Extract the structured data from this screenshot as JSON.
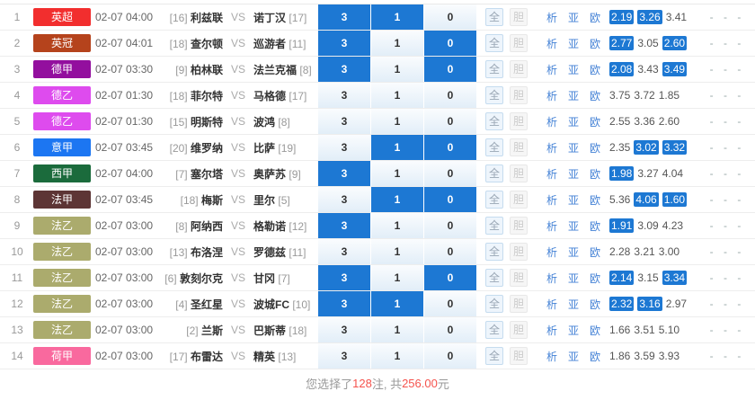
{
  "controls": {
    "pick_labels": [
      "3",
      "1",
      "0"
    ],
    "all_label": "全",
    "dan_label": "胆",
    "links": [
      "析",
      "亚",
      "欧"
    ],
    "vs_label": "VS",
    "dash": "- - -"
  },
  "colors": {
    "selected_blue": "#1d78d3",
    "link_blue": "#4482d6",
    "red": "#f5534d",
    "leagues": {
      "英超": "#f22e2e",
      "英冠": "#b5431c",
      "德甲": "#930f9e",
      "德乙": "#de4bee",
      "意甲": "#1c76f2",
      "西甲": "#1b6b3c",
      "法甲": "#5d3535",
      "法乙": "#abab6d",
      "荷甲": "#f9699e"
    }
  },
  "rows": [
    {
      "no": "1",
      "league": "英超",
      "time": "02-07 04:00",
      "home_rank": "[16]",
      "home": "利兹联",
      "away": "诺丁汉",
      "away_rank": "[17]",
      "picks": [
        true,
        true,
        false
      ],
      "odds": [
        "2.19",
        "3.26",
        "3.41"
      ]
    },
    {
      "no": "2",
      "league": "英冠",
      "time": "02-07 04:01",
      "home_rank": "[18]",
      "home": "查尔顿",
      "away": "巡游者",
      "away_rank": "[11]",
      "picks": [
        true,
        false,
        true
      ],
      "odds": [
        "2.77",
        "3.05",
        "2.60"
      ]
    },
    {
      "no": "3",
      "league": "德甲",
      "time": "02-07 03:30",
      "home_rank": "[9]",
      "home": "柏林联",
      "away": "法兰克福",
      "away_rank": "[8]",
      "picks": [
        true,
        false,
        true
      ],
      "odds": [
        "2.08",
        "3.43",
        "3.49"
      ]
    },
    {
      "no": "4",
      "league": "德乙",
      "time": "02-07 01:30",
      "home_rank": "[18]",
      "home": "菲尔特",
      "away": "马格德",
      "away_rank": "[17]",
      "picks": [
        false,
        false,
        false
      ],
      "odds": [
        "3.75",
        "3.72",
        "1.85"
      ]
    },
    {
      "no": "5",
      "league": "德乙",
      "time": "02-07 01:30",
      "home_rank": "[15]",
      "home": "明斯特",
      "away": "波鸿",
      "away_rank": "[8]",
      "picks": [
        false,
        false,
        false
      ],
      "odds": [
        "2.55",
        "3.36",
        "2.60"
      ]
    },
    {
      "no": "6",
      "league": "意甲",
      "time": "02-07 03:45",
      "home_rank": "[20]",
      "home": "维罗纳",
      "away": "比萨",
      "away_rank": "[19]",
      "picks": [
        false,
        true,
        true
      ],
      "odds": [
        "2.35",
        "3.02",
        "3.32"
      ]
    },
    {
      "no": "7",
      "league": "西甲",
      "time": "02-07 04:00",
      "home_rank": "[7]",
      "home": "塞尔塔",
      "away": "奥萨苏",
      "away_rank": "[9]",
      "picks": [
        true,
        false,
        false
      ],
      "odds": [
        "1.98",
        "3.27",
        "4.04"
      ]
    },
    {
      "no": "8",
      "league": "法甲",
      "time": "02-07 03:45",
      "home_rank": "[18]",
      "home": "梅斯",
      "away": "里尔",
      "away_rank": "[5]",
      "picks": [
        false,
        true,
        true
      ],
      "odds": [
        "5.36",
        "4.06",
        "1.60"
      ]
    },
    {
      "no": "9",
      "league": "法乙",
      "time": "02-07 03:00",
      "home_rank": "[8]",
      "home": "阿纳西",
      "away": "格勒诺",
      "away_rank": "[12]",
      "picks": [
        true,
        false,
        false
      ],
      "odds": [
        "1.91",
        "3.09",
        "4.23"
      ]
    },
    {
      "no": "10",
      "league": "法乙",
      "time": "02-07 03:00",
      "home_rank": "[13]",
      "home": "布洛涅",
      "away": "罗德兹",
      "away_rank": "[11]",
      "picks": [
        false,
        false,
        false
      ],
      "odds": [
        "2.28",
        "3.21",
        "3.00"
      ]
    },
    {
      "no": "11",
      "league": "法乙",
      "time": "02-07 03:00",
      "home_rank": "[6]",
      "home": "敦刻尔克",
      "away": "甘冈",
      "away_rank": "[7]",
      "picks": [
        true,
        false,
        true
      ],
      "odds": [
        "2.14",
        "3.15",
        "3.34"
      ]
    },
    {
      "no": "12",
      "league": "法乙",
      "time": "02-07 03:00",
      "home_rank": "[4]",
      "home": "圣红星",
      "away": "波城FC",
      "away_rank": "[10]",
      "picks": [
        true,
        true,
        false
      ],
      "odds": [
        "2.32",
        "3.16",
        "2.97"
      ]
    },
    {
      "no": "13",
      "league": "法乙",
      "time": "02-07 03:00",
      "home_rank": "[2]",
      "home": "兰斯",
      "away": "巴斯蒂",
      "away_rank": "[18]",
      "picks": [
        false,
        false,
        false
      ],
      "odds": [
        "1.66",
        "3.51",
        "5.10"
      ]
    },
    {
      "no": "14",
      "league": "荷甲",
      "time": "02-07 03:00",
      "home_rank": "[17]",
      "home": "布雷达",
      "away": "精英",
      "away_rank": "[13]",
      "picks": [
        false,
        false,
        false
      ],
      "odds": [
        "1.86",
        "3.59",
        "3.93"
      ]
    }
  ],
  "footer": {
    "prefix": "您选择了 ",
    "bets": "128",
    "middle": " 注, 共 ",
    "amount": "256.00",
    "suffix": "元"
  }
}
